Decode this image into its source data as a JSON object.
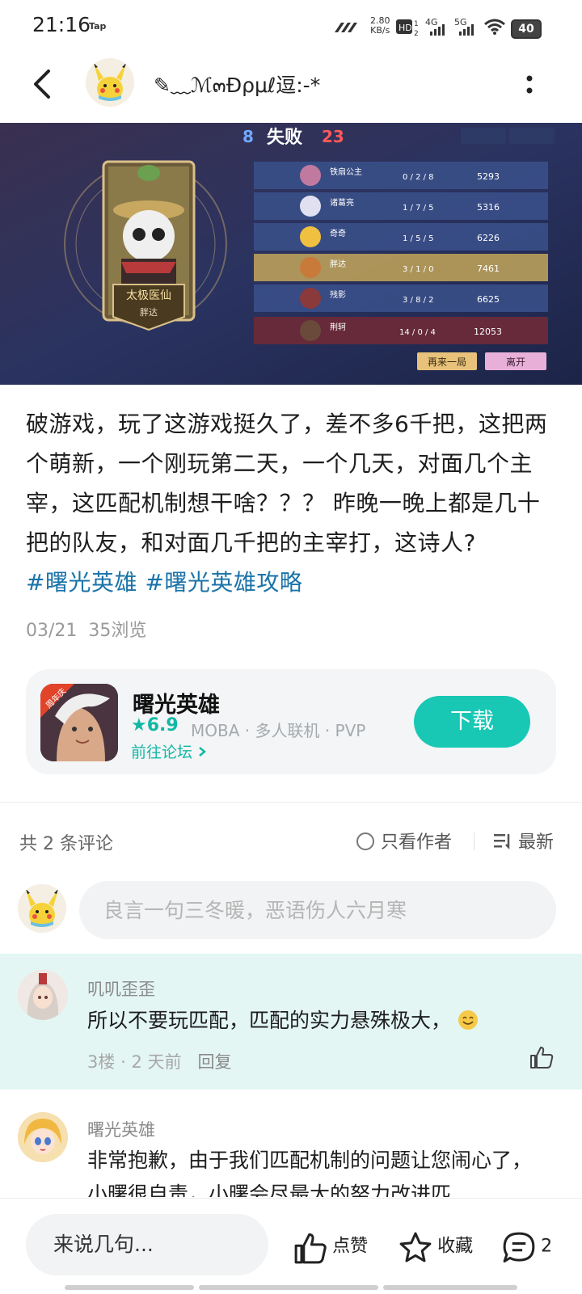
{
  "status_bar": {
    "time": "21:16",
    "tap": "Tap",
    "speed": "2.80",
    "speed_unit": "KB/s",
    "battery": "40"
  },
  "header": {
    "username": "✎﹏ℳ๓Ðρμℓ逗:-*",
    "back_icon": "chevron-left-icon",
    "more_icon": "more-vertical-icon"
  },
  "game_screenshot": {
    "score_left": "8",
    "result": "失败",
    "score_right": "23",
    "hero_name": "太极医仙",
    "hero_sub": "胖达",
    "btn_again": "再来一局",
    "btn_leave": "离开",
    "players": [
      {
        "name": "铁扇公主",
        "kda": "0 / 2 / 8",
        "score": "5293"
      },
      {
        "name": "诸葛亮",
        "kda": "1 / 7 / 5",
        "score": "5316"
      },
      {
        "name": "奇奇",
        "kda": "1 / 5 / 5",
        "score": "6226"
      },
      {
        "name": "胖达",
        "kda": "3 / 1 / 0",
        "score": "7461"
      },
      {
        "name": "残影",
        "kda": "3 / 8 / 2",
        "score": "6625"
      },
      {
        "name": "荆轲",
        "kda": "14 / 0 / 4",
        "score": "12053"
      }
    ]
  },
  "post": {
    "text": "破游戏，玩了这游戏挺久了，差不多6千把，这把两个萌新，一个刚玩第二天，一个几天，对面几个主宰，这匹配机制想干啥？？？ 昨晚一晚上都是几十把的队友，和对面几千把的主宰打，这诗人?",
    "tags": [
      "#曙光英雄",
      "#曙光英雄攻略"
    ],
    "date": "03/21",
    "views": "35浏览"
  },
  "app_card": {
    "name": "曙光英雄",
    "badge": "周年庆",
    "rating": "6.9",
    "tags": "MOBA · 多人联机 · PVP",
    "forum_link": "前往论坛",
    "download": "下载"
  },
  "comments_header": {
    "count": "共 2 条评论",
    "author_only": "只看作者",
    "sort": "最新"
  },
  "comment_input": {
    "placeholder": "良言一句三冬暖，恶语伤人六月寒"
  },
  "comments": [
    {
      "user": "叽叽歪歪",
      "text": "所以不要玩匹配，匹配的实力悬殊极大，",
      "floor": "3楼",
      "time": "2 天前",
      "reply": "回复"
    },
    {
      "user": "曙光英雄",
      "text": "非常抱歉，由于我们匹配机制的问题让您闹心了，小曙很自责，小曙会尽最大的努力改进匹"
    }
  ],
  "bottom_bar": {
    "say": "来说几句...",
    "like": "点赞",
    "collect": "收藏",
    "comment_count": "2"
  }
}
